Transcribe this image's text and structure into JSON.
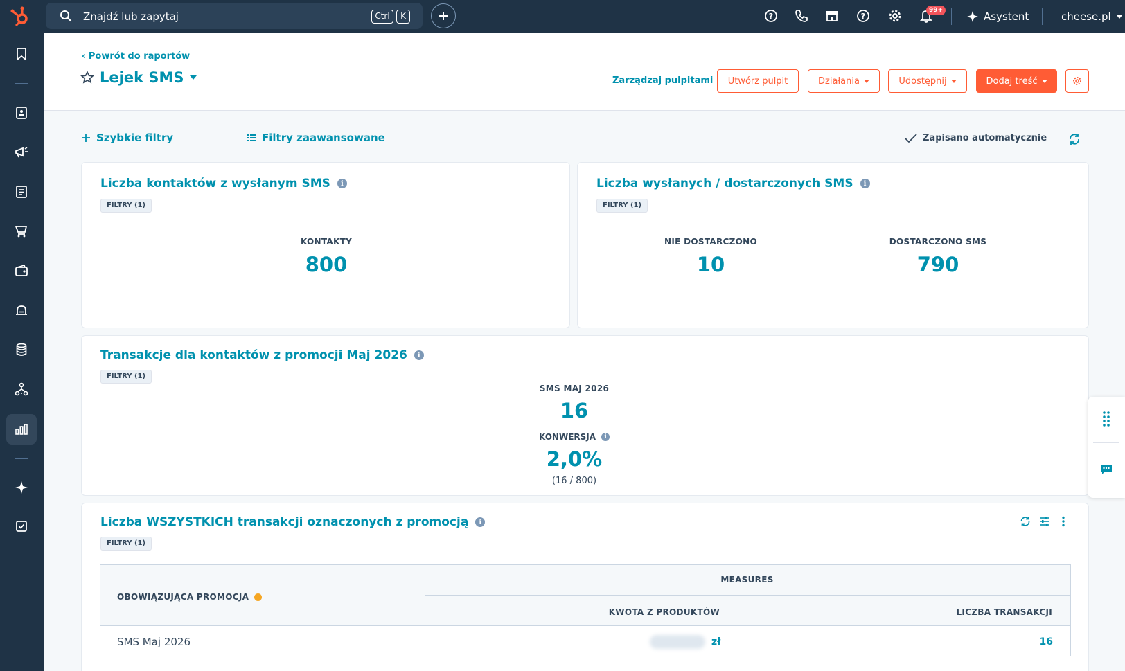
{
  "topbar": {
    "search_placeholder": "Znajdź lub zapytaj",
    "kbd_ctrl": "Ctrl",
    "kbd_k": "K",
    "notification_badge": "99+",
    "assistant_label": "Asystent",
    "account_name": "cheese.pl"
  },
  "header": {
    "back_link": "‹ Powrót do raportów",
    "title": "Lejek SMS",
    "manage_link": "Zarządzaj pulpitami",
    "create_button": "Utwórz pulpit",
    "actions_button": "Działania",
    "share_button": "Udostępnij",
    "add_content_button": "Dodaj treść"
  },
  "filters": {
    "quick": "Szybkie filtry",
    "advanced": "Filtry zaawansowane",
    "autosave": "Zapisano automatycznie"
  },
  "cards": {
    "contacts": {
      "title": "Liczba kontaktów z wysłanym SMS",
      "tag": "FILTRY (1)",
      "label": "KONTAKTY",
      "value": "800"
    },
    "delivery": {
      "title": "Liczba wysłanych / dostarczonych SMS",
      "tag": "FILTRY (1)",
      "not_delivered_label": "NIE DOSTARCZONO",
      "not_delivered_value": "10",
      "delivered_label": "DOSTARCZONO SMS",
      "delivered_value": "790"
    },
    "transactions": {
      "title": "Transakcje dla kontaktów z promocji Maj 2026",
      "tag": "FILTRY (1)",
      "sms_label": "SMS MAJ 2026",
      "sms_value": "16",
      "conversion_label": "KONWERSJA",
      "conversion_value": "2,0%",
      "conversion_detail": "(16 / 800)"
    },
    "all_transactions": {
      "title": "Liczba WSZYSTKICH transakcji oznaczonych z promocją",
      "tag": "FILTRY (1)",
      "table": {
        "row_header": "OBOWIĄZUJĄCA PROMOCJA",
        "group_header": "MEASURES",
        "col_amount": "KWOTA Z PRODUKTÓW",
        "col_count": "LICZBA TRANSAKCJI",
        "rows": [
          {
            "promotion": "SMS Maj 2026",
            "amount_currency": "zł",
            "count": "16"
          }
        ]
      }
    }
  },
  "colors": {
    "brand_orange": "#ff5c35",
    "link_teal": "#0091ae",
    "nav_dark": "#1f3346"
  }
}
